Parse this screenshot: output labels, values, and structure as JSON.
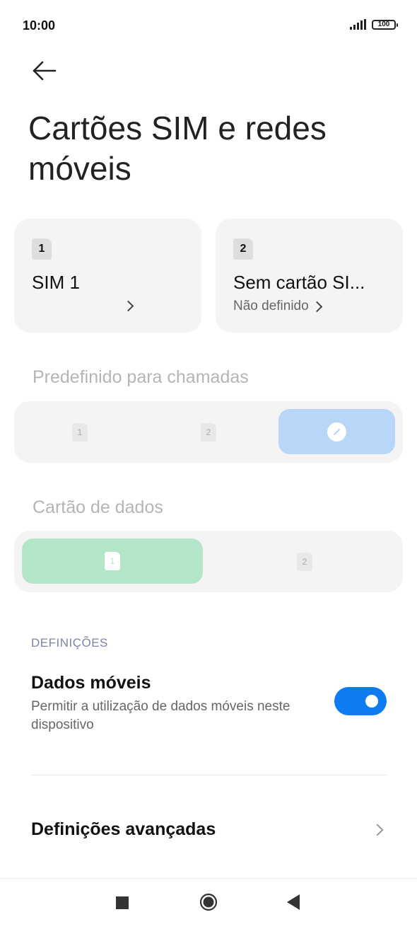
{
  "status_bar": {
    "time": "10:00",
    "battery": "100"
  },
  "header": {
    "title": "Cartões SIM e redes móveis"
  },
  "sim_cards": [
    {
      "slot": "1",
      "name": "SIM 1",
      "subtitle": ""
    },
    {
      "slot": "2",
      "name": "Sem cartão SI...",
      "subtitle": "Não definido"
    }
  ],
  "calls": {
    "label": "Predefinido para chamadas",
    "options": [
      "1",
      "2"
    ]
  },
  "data_card": {
    "label": "Cartão de dados",
    "options": [
      "1",
      "2"
    ]
  },
  "settings": {
    "header": "DEFINIÇÕES",
    "mobile_data": {
      "title": "Dados móveis",
      "description": "Permitir a utilização de dados móveis neste dispositivo",
      "enabled": true
    },
    "advanced": {
      "title": "Definições avançadas"
    }
  },
  "colors": {
    "accent": "#0e7cf0",
    "calls_selected": "#b8d6f8",
    "data_selected": "#b3e6c9",
    "section_header": "#7d85a3"
  }
}
